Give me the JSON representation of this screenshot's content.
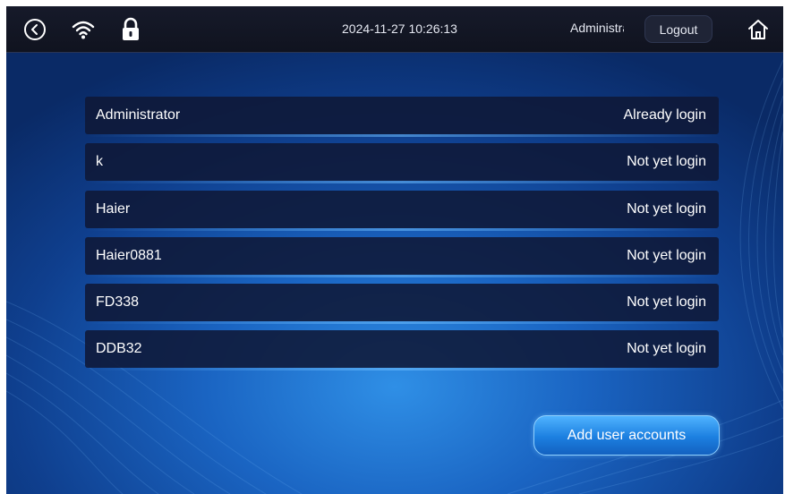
{
  "topbar": {
    "datetime": "2024-11-27 10:26:13",
    "current_user": "Administrator",
    "logout_label": "Logout",
    "icons": [
      "back-icon",
      "wifi-icon",
      "lock-icon",
      "home-icon"
    ]
  },
  "accounts": [
    {
      "name": "Administrator",
      "status": "Already login"
    },
    {
      "name": "k",
      "status": "Not yet login"
    },
    {
      "name": "Haier",
      "status": "Not yet login"
    },
    {
      "name": "Haier0881",
      "status": "Not yet login"
    },
    {
      "name": "FD338",
      "status": "Not yet login"
    },
    {
      "name": "DDB32",
      "status": "Not yet login"
    }
  ],
  "add_button_label": "Add user accounts",
  "colors": {
    "accent": "#1c7fe0",
    "row_bg": "#0f1837",
    "topbar_bg": "#161a2a"
  }
}
